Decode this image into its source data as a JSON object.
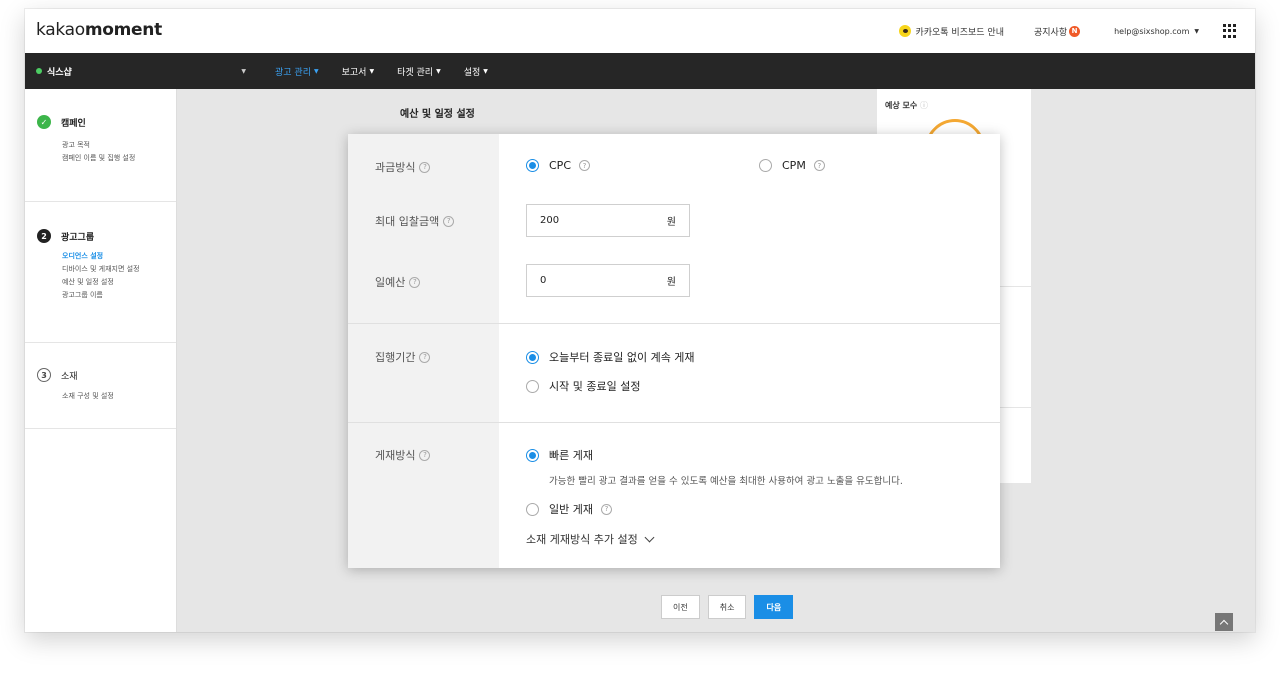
{
  "header": {
    "logo_light": "kakao",
    "logo_bold": "moment",
    "biz_board_link": "카카오톡 비즈보드 안내",
    "notice": "공지사항",
    "notice_badge": "N",
    "account": "help@sixshop.com"
  },
  "nav": {
    "shop_name": "식스샵",
    "menus": [
      {
        "label": "광고 관리",
        "active": true
      },
      {
        "label": "보고서",
        "active": false
      },
      {
        "label": "타겟 관리",
        "active": false
      },
      {
        "label": "설정",
        "active": false
      }
    ]
  },
  "sidebar": {
    "steps": [
      {
        "icon": "check-icon",
        "title": "캠페인",
        "items": [
          "광고 목적",
          "캠페인 이름 및 집행 설정"
        ]
      },
      {
        "icon": "number-2",
        "number": "2",
        "title": "광고그룹",
        "items": [
          "오디언스 설정",
          "디바이스 및 게재지면 설정",
          "예산 및 일정 설정",
          "광고그룹 이름"
        ],
        "active_item": "오디언스 설정"
      },
      {
        "icon": "number-3",
        "number": "3",
        "title": "소재",
        "items": [
          "소재 구성 및 설정"
        ]
      }
    ]
  },
  "main": {
    "section_title": "예산 및 일정 설정",
    "side_card_label": "예상 모수"
  },
  "modal": {
    "billing": {
      "label": "과금방식",
      "options": [
        {
          "label": "CPC",
          "selected": true
        },
        {
          "label": "CPM",
          "selected": false
        }
      ]
    },
    "max_bid": {
      "label": "최대 입찰금액",
      "value": "200",
      "unit": "원"
    },
    "daily_budget": {
      "label": "일예산",
      "value": "0",
      "unit": "원"
    },
    "period": {
      "label": "집행기간",
      "options": [
        {
          "label": "오늘부터 종료일 없이 계속 게재",
          "selected": true
        },
        {
          "label": "시작 및 종료일 설정",
          "selected": false
        }
      ]
    },
    "delivery": {
      "label": "게재방식",
      "options": [
        {
          "label": "빠른 게재",
          "selected": true
        },
        {
          "label": "일반 게재",
          "selected": false
        }
      ],
      "fast_desc": "가능한 빨리 광고 결과를 얻을 수 있도록 예산을 최대한 사용하여 광고 노출을 유도합니다.",
      "more_settings": "소재 게재방식 추가 설정"
    },
    "help_mark": "?"
  },
  "footer": {
    "prev": "이전",
    "cancel": "취소",
    "next": "다음"
  },
  "colors": {
    "accent": "#1a8ee6",
    "nav_bg": "#262626",
    "done_green": "#3cb54a"
  }
}
